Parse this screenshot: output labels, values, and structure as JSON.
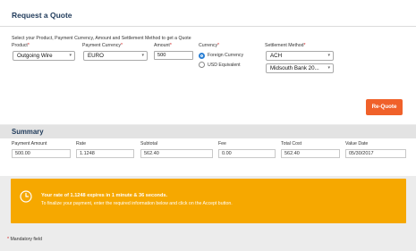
{
  "header": {
    "title": "Request a Quote"
  },
  "instructions": "Select your Product, Payment Currency, Amount and Settlement Method to get a Quote",
  "form": {
    "product": {
      "label": "Product",
      "value": "Outgoing Wire"
    },
    "payment_currency": {
      "label": "Payment Currency",
      "value": "EURO"
    },
    "amount": {
      "label": "Amount",
      "value": "500"
    },
    "currency": {
      "label": "Currency",
      "options": [
        "Foreign Currency",
        "USD Equivalent"
      ],
      "selected": "Foreign Currency"
    },
    "settlement_method": {
      "label": "Settlement Method",
      "value": "ACH",
      "account": "Midsouth Bank 20..."
    },
    "required_marker": "*"
  },
  "requote_label": "Re-Quote",
  "summary": {
    "title": "Summary",
    "fields": [
      {
        "label": "Payment Amount",
        "value": "500.00"
      },
      {
        "label": "Rate",
        "value": "1.1248"
      },
      {
        "label": "Subtotal",
        "value": "562.40"
      },
      {
        "label": "Fee",
        "value": "0.00"
      },
      {
        "label": "Total Cost",
        "value": "562.40"
      },
      {
        "label": "Value Date",
        "value": "05/30/2017"
      }
    ]
  },
  "notice": {
    "line1": "Your rate of 1.1248 expires in 1 minute & 36 seconds.",
    "line2": "To finalize your payment, enter the required information below and click on the Accept button."
  },
  "footer": {
    "mandatory_label": "Mandatory field"
  },
  "colors": {
    "accent_orange": "#f0612a",
    "notice_bg": "#f6a800",
    "radio_blue": "#2a7fd4",
    "title_navy": "#1f3a5a",
    "required_red": "#d02020"
  },
  "icons": {
    "notice": "clock-icon",
    "dropdown": "chevron-down-icon"
  }
}
